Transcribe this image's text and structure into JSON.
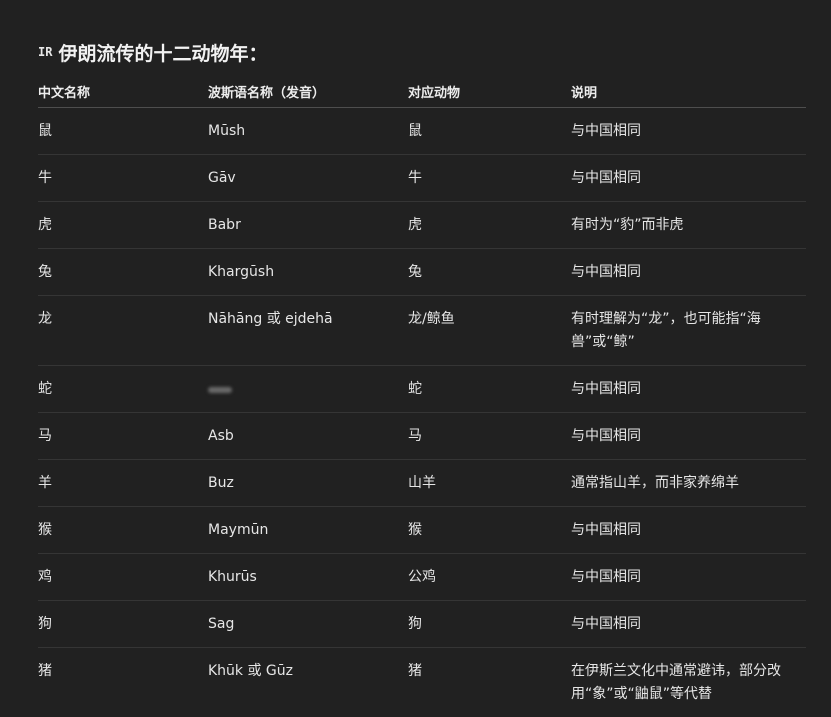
{
  "heading": {
    "flag": "IR",
    "title": "伊朗流传的十二动物年："
  },
  "table": {
    "headers": [
      "中文名称",
      "波斯语名称（发音）",
      "对应动物",
      "说明"
    ],
    "rows": [
      {
        "cn": "鼠",
        "fa": "Mūsh",
        "animal": "鼠",
        "note": "与中国相同"
      },
      {
        "cn": "牛",
        "fa": "Gāv",
        "animal": "牛",
        "note": "与中国相同"
      },
      {
        "cn": "虎",
        "fa": "Babr",
        "animal": "虎",
        "note": "有时为“豹”而非虎"
      },
      {
        "cn": "兔",
        "fa": "Khargūsh",
        "animal": "兔",
        "note": "与中国相同"
      },
      {
        "cn": "龙",
        "fa": "Nāhāng 或 ejdehā",
        "animal": "龙/鲸鱼",
        "note": "有时理解为“龙”，也可能指“海兽”或“鲸”"
      },
      {
        "cn": "蛇",
        "fa": "",
        "animal": "蛇",
        "note": "与中国相同"
      },
      {
        "cn": "马",
        "fa": "Asb",
        "animal": "马",
        "note": "与中国相同"
      },
      {
        "cn": "羊",
        "fa": "Buz",
        "animal": "山羊",
        "note": "通常指山羊，而非家养绵羊"
      },
      {
        "cn": "猴",
        "fa": "Maymūn",
        "animal": "猴",
        "note": "与中国相同"
      },
      {
        "cn": "鸡",
        "fa": "Khurūs",
        "animal": "公鸡",
        "note": "与中国相同"
      },
      {
        "cn": "狗",
        "fa": "Sag",
        "animal": "狗",
        "note": "与中国相同"
      },
      {
        "cn": "猪",
        "fa": "Khūk 或 Gūz",
        "animal": "猪",
        "note": "在伊斯兰文化中通常避讳，部分改用“象”或“鼬鼠”等代替"
      }
    ]
  }
}
